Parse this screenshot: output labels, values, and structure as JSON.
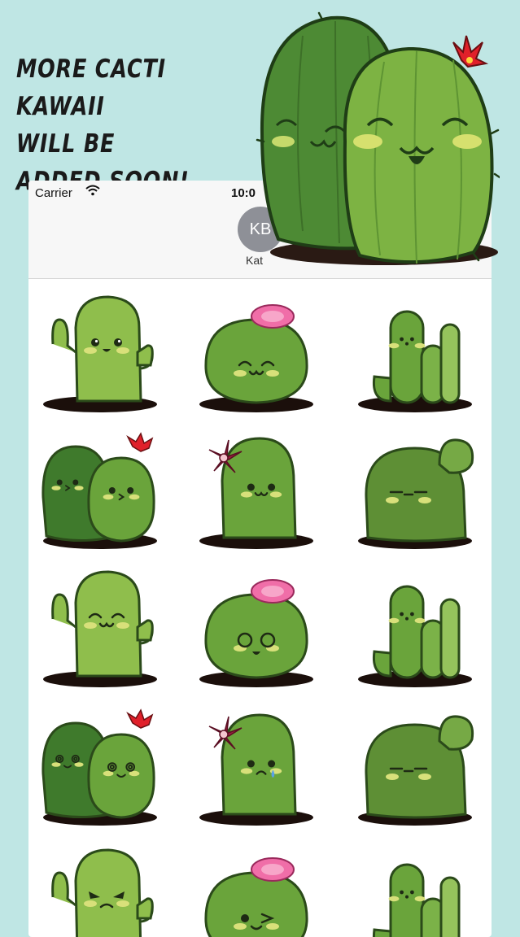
{
  "promo": {
    "line1": "More Cacti Kawaii",
    "line2": "will be added soon!"
  },
  "status_bar": {
    "carrier": "Carrier",
    "time": "10:0"
  },
  "conversation": {
    "avatar_initials": "KB",
    "contact_name": "Kat"
  },
  "stickers": [
    {
      "kind": "tall-arms",
      "face": "happy"
    },
    {
      "kind": "round-flower",
      "face": "closed-smile"
    },
    {
      "kind": "columns",
      "face": "dots"
    },
    {
      "kind": "pair",
      "face": "kiss"
    },
    {
      "kind": "tall-flower",
      "face": "cat"
    },
    {
      "kind": "blob-side",
      "face": "flat"
    },
    {
      "kind": "tall-arms",
      "face": "closed-smile"
    },
    {
      "kind": "round-flower",
      "face": "surprised"
    },
    {
      "kind": "columns",
      "face": "dots"
    },
    {
      "kind": "pair",
      "face": "dizzy"
    },
    {
      "kind": "tall-flower",
      "face": "sad"
    },
    {
      "kind": "blob-side",
      "face": "flat"
    },
    {
      "kind": "tall-arms",
      "face": "angry"
    },
    {
      "kind": "round-flower",
      "face": "wink"
    },
    {
      "kind": "columns",
      "face": "dots"
    }
  ],
  "colors": {
    "background": "#bfe6e4",
    "cactus_light": "#8fbe4c",
    "cactus_mid": "#6aa43b",
    "cactus_dark": "#3f7a2c",
    "flower_pink": "#f06ea8",
    "flower_red": "#e0202a",
    "flower_maroon": "#9c1f3f"
  }
}
